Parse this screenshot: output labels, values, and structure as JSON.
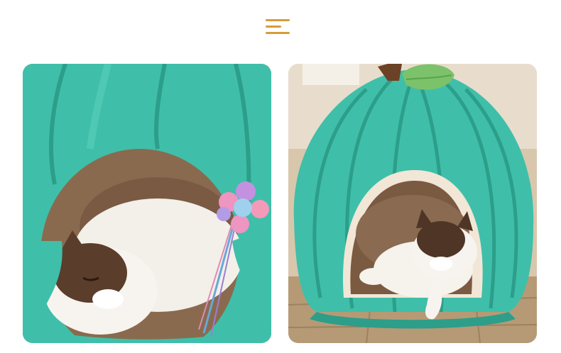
{
  "header": {
    "icon": "menu-icon",
    "accent_color": "#d79c3a"
  },
  "photos": [
    {
      "name": "cat-bed-closeup-photo",
      "description_icon": "photo"
    },
    {
      "name": "cat-bed-full-photo",
      "description_icon": "photo"
    }
  ],
  "colors": {
    "bed_teal": "#3fbfa9",
    "bed_teal_dark": "#2c9e8a",
    "floor_wood": "#b69a76",
    "leaf_green": "#7cc26a",
    "stem_brown": "#6b4226"
  }
}
